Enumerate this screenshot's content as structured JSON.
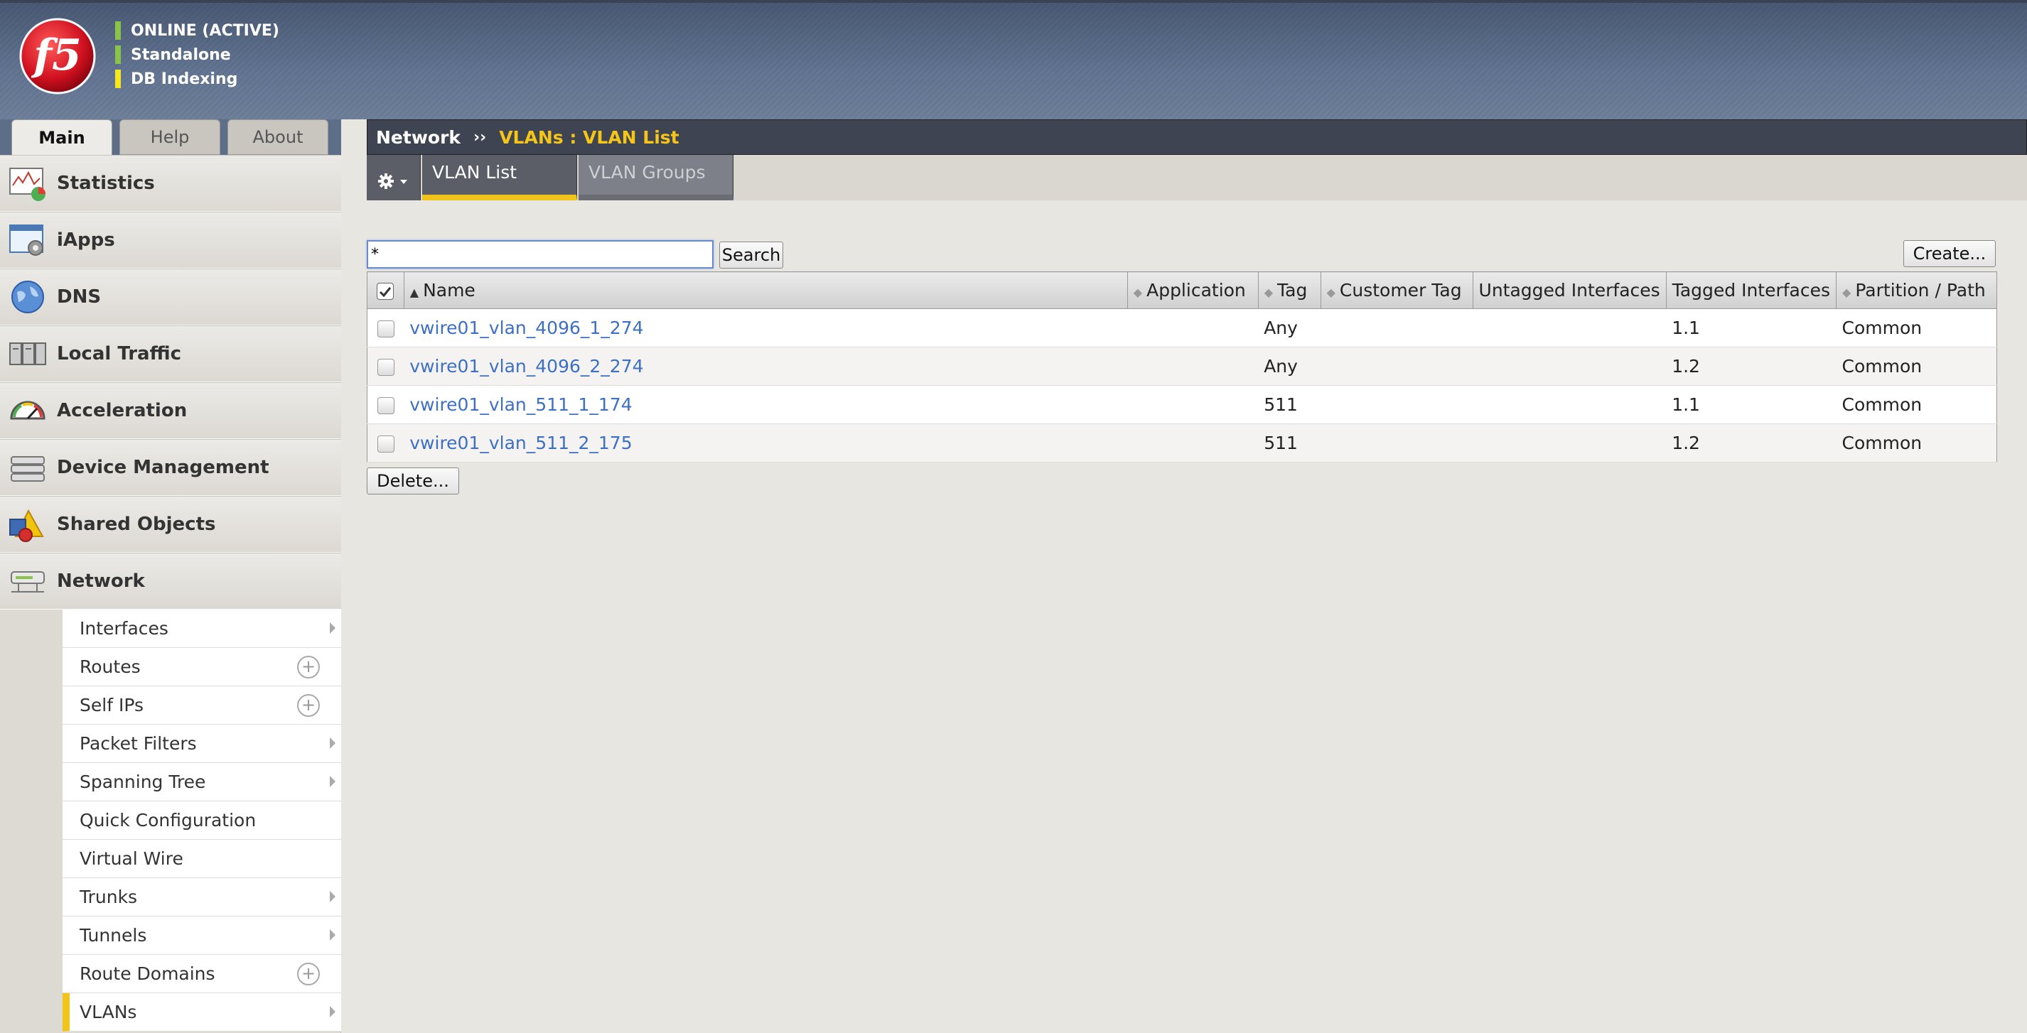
{
  "header": {
    "status": [
      {
        "label": "ONLINE (ACTIVE)",
        "color": "#8bc34a"
      },
      {
        "label": "Standalone",
        "color": "#8bc34a"
      },
      {
        "label": "DB Indexing",
        "color": "#f5e81c"
      }
    ],
    "logo_text": "f5"
  },
  "nav_tabs": [
    {
      "label": "Main",
      "active": true
    },
    {
      "label": "Help",
      "active": false
    },
    {
      "label": "About",
      "active": false
    }
  ],
  "sidebar": {
    "items": [
      {
        "label": "Statistics",
        "icon": "statistics-icon"
      },
      {
        "label": "iApps",
        "icon": "iapps-icon"
      },
      {
        "label": "DNS",
        "icon": "dns-globe-icon"
      },
      {
        "label": "Local Traffic",
        "icon": "local-traffic-icon"
      },
      {
        "label": "Acceleration",
        "icon": "speedometer-icon"
      },
      {
        "label": "Device Management",
        "icon": "device-management-icon"
      },
      {
        "label": "Shared Objects",
        "icon": "shared-objects-icon"
      },
      {
        "label": "Network",
        "icon": "network-icon"
      }
    ],
    "submenu": [
      {
        "label": "Interfaces",
        "marker": "arrow"
      },
      {
        "label": "Routes",
        "marker": "plus"
      },
      {
        "label": "Self IPs",
        "marker": "plus"
      },
      {
        "label": "Packet Filters",
        "marker": "arrow"
      },
      {
        "label": "Spanning Tree",
        "marker": "arrow"
      },
      {
        "label": "Quick Configuration",
        "marker": "none"
      },
      {
        "label": "Virtual Wire",
        "marker": "none"
      },
      {
        "label": "Trunks",
        "marker": "arrow"
      },
      {
        "label": "Tunnels",
        "marker": "arrow"
      },
      {
        "label": "Route Domains",
        "marker": "plus"
      },
      {
        "label": "VLANs",
        "marker": "arrow",
        "selected": true
      }
    ]
  },
  "breadcrumb": {
    "root": "Network",
    "separator": "››",
    "page": "VLANs : VLAN List"
  },
  "content_tabs": {
    "gear_icon": "gear-icon",
    "tabs": [
      {
        "label": "VLAN List",
        "active": true
      },
      {
        "label": "VLAN Groups",
        "active": false
      }
    ]
  },
  "search": {
    "value": "*",
    "button_label": "Search"
  },
  "create_label": "Create...",
  "delete_label": "Delete...",
  "table": {
    "columns": [
      "Name",
      "Application",
      "Tag",
      "Customer Tag",
      "Untagged Interfaces",
      "Tagged Interfaces",
      "Partition / Path"
    ],
    "rows": [
      {
        "name": "vwire01_vlan_4096_1_274",
        "application": "",
        "tag": "Any",
        "customer_tag": "",
        "untagged": "",
        "tagged": "1.1",
        "partition": "Common"
      },
      {
        "name": "vwire01_vlan_4096_2_274",
        "application": "",
        "tag": "Any",
        "customer_tag": "",
        "untagged": "",
        "tagged": "1.2",
        "partition": "Common"
      },
      {
        "name": "vwire01_vlan_511_1_174",
        "application": "",
        "tag": "511",
        "customer_tag": "",
        "untagged": "",
        "tagged": "1.1",
        "partition": "Common"
      },
      {
        "name": "vwire01_vlan_511_2_175",
        "application": "",
        "tag": "511",
        "customer_tag": "",
        "untagged": "",
        "tagged": "1.2",
        "partition": "Common"
      }
    ]
  },
  "colors": {
    "accent_yellow": "#f0c419",
    "link_blue": "#3d6fc4",
    "breadcrumb_bg": "#3f4452"
  }
}
